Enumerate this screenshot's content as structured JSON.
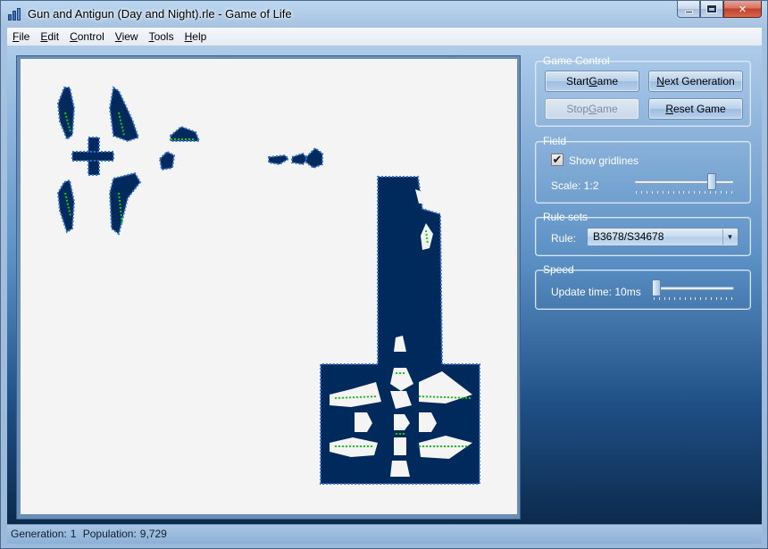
{
  "window": {
    "title": "Gun and Antigun (Day and Night).rle - Game of Life",
    "close_glyph": "✕"
  },
  "menu": [
    {
      "acc": "F",
      "rest": "ile"
    },
    {
      "acc": "E",
      "rest": "dit"
    },
    {
      "acc": "C",
      "rest": "ontrol"
    },
    {
      "acc": "V",
      "rest": "iew"
    },
    {
      "acc": "T",
      "rest": "ools"
    },
    {
      "acc": "H",
      "rest": "elp"
    }
  ],
  "game_control": {
    "title": "Game Control",
    "start": {
      "pre": "Start ",
      "acc": "G",
      "post": "ame"
    },
    "next": {
      "pre": "",
      "acc": "N",
      "post": "ext Generation"
    },
    "stop": {
      "pre": "Stop ",
      "acc": "G",
      "post": "ame"
    },
    "reset": {
      "pre": "",
      "acc": "R",
      "post": "eset Game"
    }
  },
  "field": {
    "title": "Field",
    "show_gridlines_label": "Show gridlines",
    "show_gridlines_checked": true,
    "check_glyph": "✔",
    "scale_label": "Scale: 1:2",
    "scale_slider_value": 0.8
  },
  "rule_sets": {
    "title": "Rule sets",
    "rule_label": "Rule:",
    "rule_value": "B3678/S34678",
    "arrow_glyph": "▼"
  },
  "speed": {
    "title": "Speed",
    "update_label": "Update time: 10ms",
    "speed_slider_value": 0.0
  },
  "status": {
    "generation_label": "Generation:",
    "generation_value": "1",
    "population_label": "Population:",
    "population_value": "9,729"
  },
  "colors": {
    "cell": "#002a5c",
    "cell_edge": "#2f6fd0",
    "cell_highlight": "#18c818",
    "board_bg": "#f4f4f4"
  }
}
